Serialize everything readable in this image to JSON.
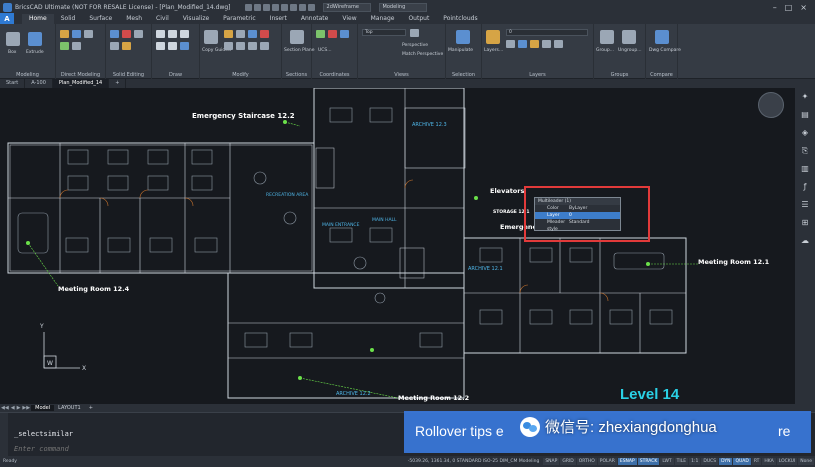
{
  "app": {
    "title": "BricsCAD Ultimate (NOT FOR RESALE License) - [Plan_Modified_14.dwg]",
    "qa_combo_1": "2dWireframe",
    "qa_combo_2": "Modeling"
  },
  "ribbon_tabs": [
    "Home",
    "Solid",
    "Surface",
    "Mesh",
    "Civil",
    "Visualize",
    "Parametric",
    "Insert",
    "Annotate",
    "View",
    "Manage",
    "Output",
    "Pointclouds"
  ],
  "ribbon_active_tab": "Home",
  "ribbon": {
    "panels": [
      {
        "title": "Modeling",
        "tools": [
          "Box",
          "Extrude"
        ]
      },
      {
        "title": "Direct Modeling",
        "tools": []
      },
      {
        "title": "Solid Editing",
        "tools": []
      },
      {
        "title": "Draw",
        "tools": []
      },
      {
        "title": "Modify",
        "tools": [
          "Copy Guided"
        ]
      },
      {
        "title": "Sections",
        "tools": [
          "Section Plane"
        ]
      },
      {
        "title": "Coordinates",
        "tools": [
          "UCS..."
        ]
      },
      {
        "title": "Views",
        "tools": [
          "Perspective",
          "Match Perspective"
        ]
      },
      {
        "title": "Selection",
        "tools": [
          "Manipulate"
        ]
      },
      {
        "title": "Layers",
        "tools": [
          "Layers..."
        ]
      },
      {
        "title": "Groups",
        "tools": [
          "Group...",
          "Ungroup..."
        ]
      },
      {
        "title": "Compare",
        "tools": [
          "Dwg Compare"
        ]
      }
    ],
    "view_combo": "Top",
    "layer_combo": "0"
  },
  "doc_tabs": [
    "Start",
    "A-100",
    "Plan_Modified_14"
  ],
  "doc_tab_active": "Plan_Modified_14",
  "drawing": {
    "labels": {
      "emergency_staircase": "Emergency Staircase 12.2",
      "archive_123": "ARCHIVE 12.3",
      "recreation": "RECREATION AREA",
      "main_entrance": "MAIN ENTRANCE",
      "main_hall": "MAIN HALL",
      "elevators": "Elevators",
      "storage": "STORAGE 12.1",
      "emergency_staircase_121": "Emergency Staircase 12.1",
      "archive_121": "ARCHIVE 12.1",
      "meeting_121": "Meeting Room 12.1",
      "meeting_124": "Meeting Room 12.4",
      "archive_122": "ARCHIVE 12.2",
      "meeting_122": "Meeting Room 12.2",
      "level": "Level 14"
    },
    "ucs": {
      "x": "X",
      "y": "Y",
      "w": "W"
    }
  },
  "quick_properties": {
    "header": "Multileader (1)",
    "rows": [
      {
        "key": "Color",
        "value": "ByLayer",
        "selected": false
      },
      {
        "key": "Layer",
        "value": "0",
        "selected": true
      },
      {
        "key": "Mleader style",
        "value": "Standard",
        "selected": false
      }
    ]
  },
  "layout_tabs": [
    "Model",
    "LAYOUT1"
  ],
  "layout_tab_active": "Model",
  "command": {
    "history": "_selectsimilar",
    "prompt": "Enter command"
  },
  "status": {
    "ready": "Ready",
    "coords": "-5039.26, 1361.34, 0  STANDARD  ISO-25  DIM_CM  Modeling",
    "buttons": [
      "SNAP",
      "GRID",
      "ORTHO",
      "POLAR",
      "ESNAP",
      "STRACK",
      "LWT",
      "TILE",
      "1:1",
      "DUCS",
      "DYN",
      "QUAD",
      "RT",
      "HKA",
      "LOCKUI",
      "None"
    ],
    "on_buttons": [
      "ESNAP",
      "STRACK",
      "DYN",
      "QUAD"
    ]
  },
  "overlay": {
    "rollover_text": "Rollover tips e",
    "rollover_tail": "re",
    "watermark": "微信号: zhexiangdonghua"
  },
  "colors": {
    "accent": "#2f7ad3",
    "highlight_box": "#e23a3a",
    "level_text": "#2ad1e6",
    "room_label": "#ffffff",
    "hatch_label": "#4fb6e8"
  }
}
